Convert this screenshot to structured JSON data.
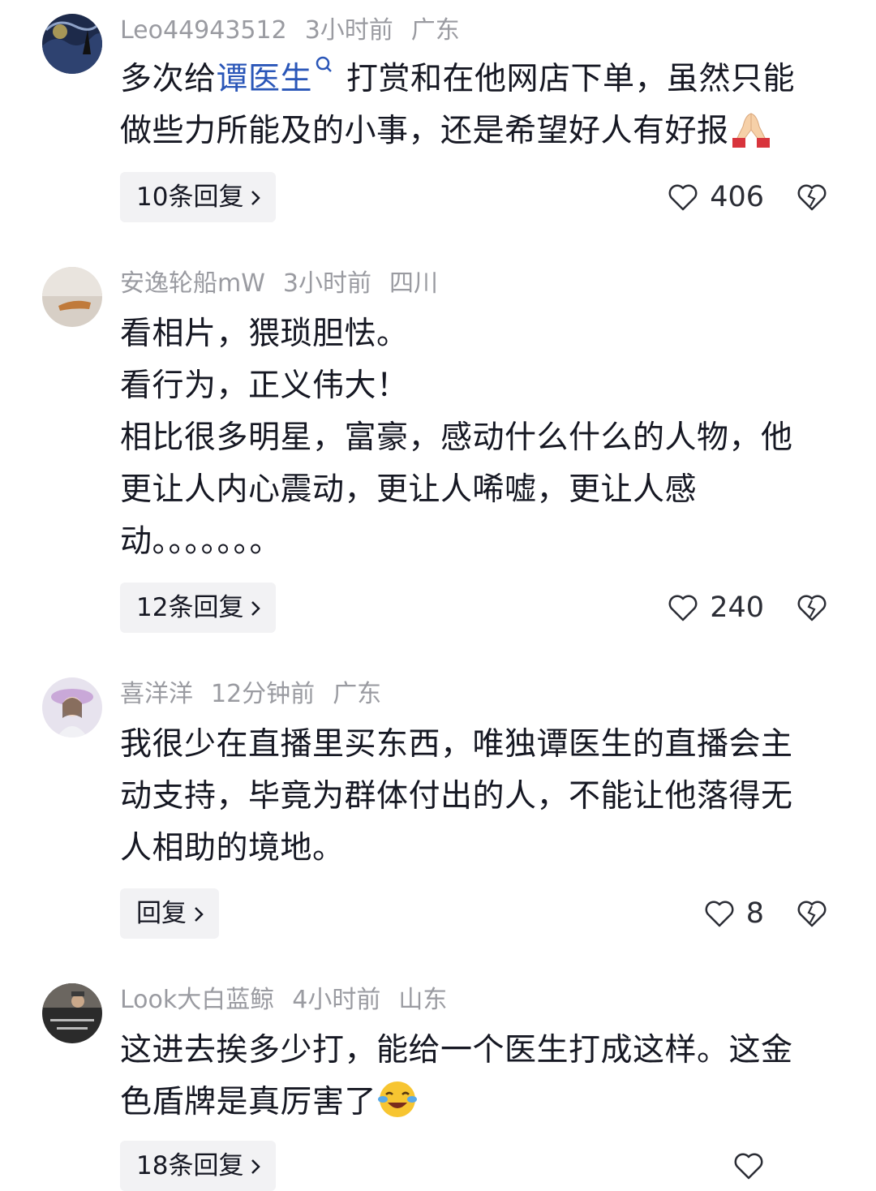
{
  "comments": [
    {
      "username": "Leo44943512",
      "time": "3小时前",
      "location": "广东",
      "text_pre": "多次给",
      "text_link": "谭医生",
      "text_post": "打赏和在他网店下单，虽然只能\n做些力所能及的小事，还是希望好人有好报",
      "emoji": "pray-emoji",
      "reply_label": "10条回复",
      "likes": "406"
    },
    {
      "username": "安逸轮船mW",
      "time": "3小时前",
      "location": "四川",
      "text": "看相片，猥琐胆怯。\n看行为，正义伟大！\n相比很多明星，富豪，感动什么什么的人物，他\n更让人内心震动，更让人唏嘘，更让人感\n动。。。。。。。",
      "reply_label": "12条回复",
      "likes": "240"
    },
    {
      "username": "喜洋洋",
      "time": "12分钟前",
      "location": "广东",
      "text": "我很少在直播里买东西，唯独谭医生的直播会主\n动支持，毕竟为群体付出的人，不能让他落得无\n人相助的境地。",
      "reply_label": "回复",
      "likes": "8"
    },
    {
      "username": "Look大白蓝鲸",
      "time": "4小时前",
      "location": "山东",
      "text": "这进去挨多少打，能给一个医生打成这样。这金\n色盾牌是真厉害了",
      "emoji": "laughing-crying-emoji",
      "reply_label": "18条回复"
    }
  ],
  "icons": {
    "like": "heart-outline-icon",
    "dislike": "broken-heart-icon",
    "chevron": "chevron-right-icon",
    "search": "search-icon"
  },
  "colors": {
    "link": "#2a56b8",
    "meta": "#9a9ba1",
    "button_bg": "#f2f2f4"
  }
}
